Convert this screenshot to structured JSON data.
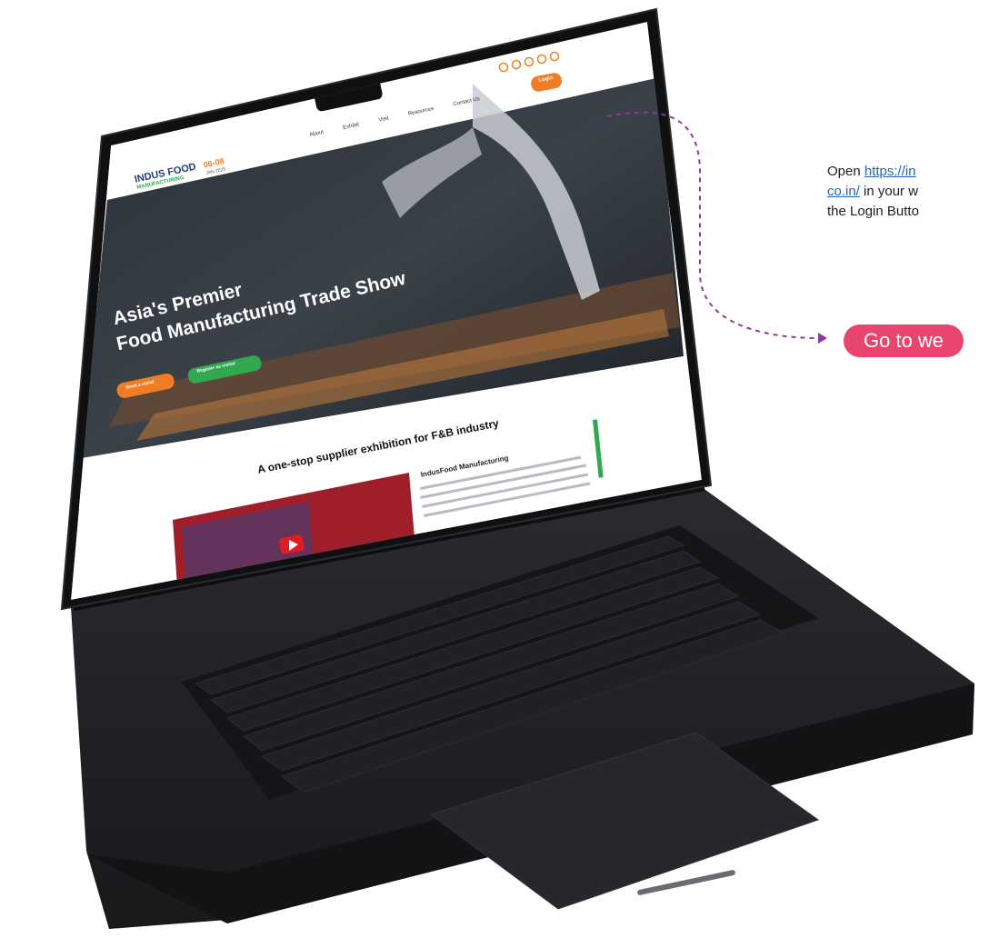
{
  "site": {
    "logo_line1": "INDUS",
    "logo_line2": "FOOD",
    "logo_sub": "MANUFACTURING",
    "date": "06-08",
    "date_sub": "JAN 2025",
    "nav": [
      "About",
      "Exhibit",
      "Visit",
      "Resources",
      "Contact Us"
    ],
    "login": "Login",
    "hero_line1": "Asia's Premier",
    "hero_line2": "Food Manufacturing Trade Show",
    "hero_btn_book": "Book a stand",
    "hero_btn_register": "Register as visitor",
    "section_title": "A one-stop supplier exhibition for F&B industry",
    "card_title": "IndusFood Manufacturing"
  },
  "instruction": {
    "prefix": "Open ",
    "link_part1": "https://in",
    "link_part2": "co.in/",
    "line2_suffix": " in your w",
    "line3": "the Login Butto"
  },
  "cta": {
    "label": "Go to we"
  },
  "colors": {
    "accent_orange": "#f07d23",
    "accent_green": "#2fa84f",
    "cta_pink": "#e8456e",
    "connector_purple": "#8a3aa0",
    "laptop_body": "#1e1f22"
  }
}
